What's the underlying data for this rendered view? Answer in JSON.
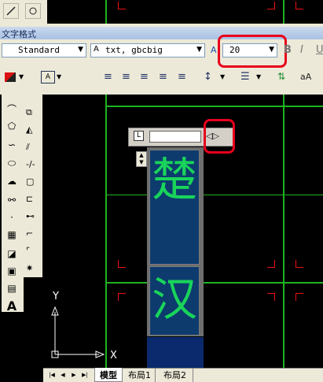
{
  "top_toolbar": {
    "icons": [
      "line-icon",
      "snap-icon"
    ]
  },
  "text_format": {
    "title": "文字格式",
    "style_value": "Standard",
    "font_value": "txt, gbcbig",
    "height_value": "20",
    "bold_label": "B",
    "italic_label": "I",
    "underline_label": "U",
    "caps_label": "aA"
  },
  "editor": {
    "ruler_marker": "L",
    "nav_arrows": "◁▷",
    "characters": [
      "楚",
      "汉"
    ]
  },
  "ucs": {
    "y_label": "Y",
    "x_label": "X"
  },
  "layout_tabs": {
    "nav_buttons": [
      "|◀",
      "◀",
      "▶",
      "▶|"
    ],
    "tabs": [
      "模型",
      "布局1",
      "布局2"
    ],
    "active_tab": "模型"
  },
  "colors": {
    "canvas": "#000000",
    "grid": "#1fb31f",
    "corner_marks": "#e11111",
    "highlight": "#e8001c",
    "editor_bg": "#0d3b6e",
    "editor_text": "#19d45a"
  }
}
